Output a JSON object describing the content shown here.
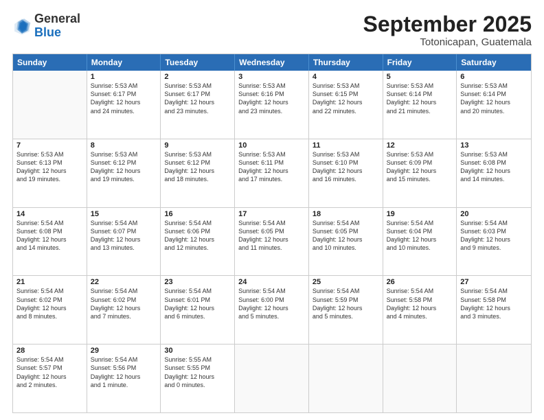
{
  "logo": {
    "general": "General",
    "blue": "Blue"
  },
  "header": {
    "month_year": "September 2025",
    "location": "Totonicapan, Guatemala"
  },
  "days_of_week": [
    "Sunday",
    "Monday",
    "Tuesday",
    "Wednesday",
    "Thursday",
    "Friday",
    "Saturday"
  ],
  "weeks": [
    [
      {
        "day": "",
        "lines": []
      },
      {
        "day": "1",
        "lines": [
          "Sunrise: 5:53 AM",
          "Sunset: 6:17 PM",
          "Daylight: 12 hours",
          "and 24 minutes."
        ]
      },
      {
        "day": "2",
        "lines": [
          "Sunrise: 5:53 AM",
          "Sunset: 6:17 PM",
          "Daylight: 12 hours",
          "and 23 minutes."
        ]
      },
      {
        "day": "3",
        "lines": [
          "Sunrise: 5:53 AM",
          "Sunset: 6:16 PM",
          "Daylight: 12 hours",
          "and 23 minutes."
        ]
      },
      {
        "day": "4",
        "lines": [
          "Sunrise: 5:53 AM",
          "Sunset: 6:15 PM",
          "Daylight: 12 hours",
          "and 22 minutes."
        ]
      },
      {
        "day": "5",
        "lines": [
          "Sunrise: 5:53 AM",
          "Sunset: 6:14 PM",
          "Daylight: 12 hours",
          "and 21 minutes."
        ]
      },
      {
        "day": "6",
        "lines": [
          "Sunrise: 5:53 AM",
          "Sunset: 6:14 PM",
          "Daylight: 12 hours",
          "and 20 minutes."
        ]
      }
    ],
    [
      {
        "day": "7",
        "lines": [
          "Sunrise: 5:53 AM",
          "Sunset: 6:13 PM",
          "Daylight: 12 hours",
          "and 19 minutes."
        ]
      },
      {
        "day": "8",
        "lines": [
          "Sunrise: 5:53 AM",
          "Sunset: 6:12 PM",
          "Daylight: 12 hours",
          "and 19 minutes."
        ]
      },
      {
        "day": "9",
        "lines": [
          "Sunrise: 5:53 AM",
          "Sunset: 6:12 PM",
          "Daylight: 12 hours",
          "and 18 minutes."
        ]
      },
      {
        "day": "10",
        "lines": [
          "Sunrise: 5:53 AM",
          "Sunset: 6:11 PM",
          "Daylight: 12 hours",
          "and 17 minutes."
        ]
      },
      {
        "day": "11",
        "lines": [
          "Sunrise: 5:53 AM",
          "Sunset: 6:10 PM",
          "Daylight: 12 hours",
          "and 16 minutes."
        ]
      },
      {
        "day": "12",
        "lines": [
          "Sunrise: 5:53 AM",
          "Sunset: 6:09 PM",
          "Daylight: 12 hours",
          "and 15 minutes."
        ]
      },
      {
        "day": "13",
        "lines": [
          "Sunrise: 5:53 AM",
          "Sunset: 6:08 PM",
          "Daylight: 12 hours",
          "and 14 minutes."
        ]
      }
    ],
    [
      {
        "day": "14",
        "lines": [
          "Sunrise: 5:54 AM",
          "Sunset: 6:08 PM",
          "Daylight: 12 hours",
          "and 14 minutes."
        ]
      },
      {
        "day": "15",
        "lines": [
          "Sunrise: 5:54 AM",
          "Sunset: 6:07 PM",
          "Daylight: 12 hours",
          "and 13 minutes."
        ]
      },
      {
        "day": "16",
        "lines": [
          "Sunrise: 5:54 AM",
          "Sunset: 6:06 PM",
          "Daylight: 12 hours",
          "and 12 minutes."
        ]
      },
      {
        "day": "17",
        "lines": [
          "Sunrise: 5:54 AM",
          "Sunset: 6:05 PM",
          "Daylight: 12 hours",
          "and 11 minutes."
        ]
      },
      {
        "day": "18",
        "lines": [
          "Sunrise: 5:54 AM",
          "Sunset: 6:05 PM",
          "Daylight: 12 hours",
          "and 10 minutes."
        ]
      },
      {
        "day": "19",
        "lines": [
          "Sunrise: 5:54 AM",
          "Sunset: 6:04 PM",
          "Daylight: 12 hours",
          "and 10 minutes."
        ]
      },
      {
        "day": "20",
        "lines": [
          "Sunrise: 5:54 AM",
          "Sunset: 6:03 PM",
          "Daylight: 12 hours",
          "and 9 minutes."
        ]
      }
    ],
    [
      {
        "day": "21",
        "lines": [
          "Sunrise: 5:54 AM",
          "Sunset: 6:02 PM",
          "Daylight: 12 hours",
          "and 8 minutes."
        ]
      },
      {
        "day": "22",
        "lines": [
          "Sunrise: 5:54 AM",
          "Sunset: 6:02 PM",
          "Daylight: 12 hours",
          "and 7 minutes."
        ]
      },
      {
        "day": "23",
        "lines": [
          "Sunrise: 5:54 AM",
          "Sunset: 6:01 PM",
          "Daylight: 12 hours",
          "and 6 minutes."
        ]
      },
      {
        "day": "24",
        "lines": [
          "Sunrise: 5:54 AM",
          "Sunset: 6:00 PM",
          "Daylight: 12 hours",
          "and 5 minutes."
        ]
      },
      {
        "day": "25",
        "lines": [
          "Sunrise: 5:54 AM",
          "Sunset: 5:59 PM",
          "Daylight: 12 hours",
          "and 5 minutes."
        ]
      },
      {
        "day": "26",
        "lines": [
          "Sunrise: 5:54 AM",
          "Sunset: 5:58 PM",
          "Daylight: 12 hours",
          "and 4 minutes."
        ]
      },
      {
        "day": "27",
        "lines": [
          "Sunrise: 5:54 AM",
          "Sunset: 5:58 PM",
          "Daylight: 12 hours",
          "and 3 minutes."
        ]
      }
    ],
    [
      {
        "day": "28",
        "lines": [
          "Sunrise: 5:54 AM",
          "Sunset: 5:57 PM",
          "Daylight: 12 hours",
          "and 2 minutes."
        ]
      },
      {
        "day": "29",
        "lines": [
          "Sunrise: 5:54 AM",
          "Sunset: 5:56 PM",
          "Daylight: 12 hours",
          "and 1 minute."
        ]
      },
      {
        "day": "30",
        "lines": [
          "Sunrise: 5:55 AM",
          "Sunset: 5:55 PM",
          "Daylight: 12 hours",
          "and 0 minutes."
        ]
      },
      {
        "day": "",
        "lines": []
      },
      {
        "day": "",
        "lines": []
      },
      {
        "day": "",
        "lines": []
      },
      {
        "day": "",
        "lines": []
      }
    ]
  ]
}
